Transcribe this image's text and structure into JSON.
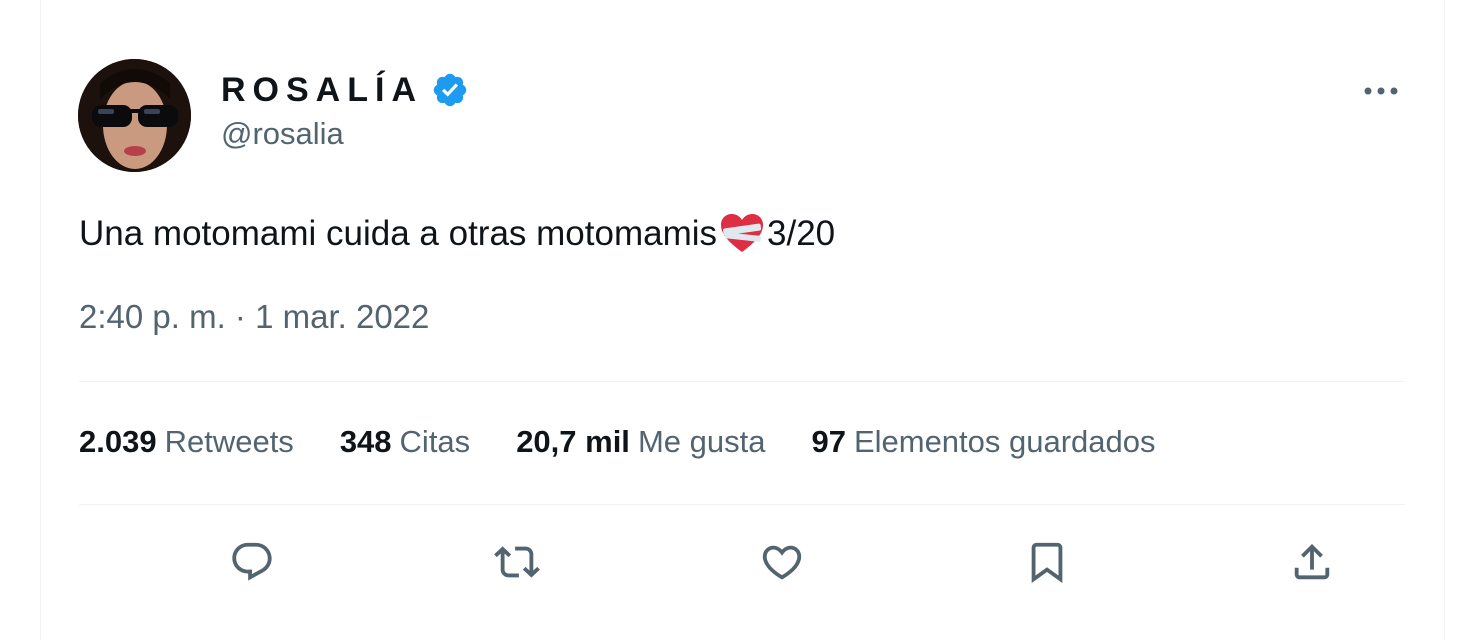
{
  "tweet": {
    "display_name": "ROSALÍA",
    "handle": "@rosalia",
    "text_before": "Una motomami cuida a otras motomamis",
    "text_after": "3/20",
    "time": "2:40 p. m.",
    "separator": "·",
    "date": "1 mar. 2022"
  },
  "stats": {
    "retweets": {
      "count": "2.039",
      "label": "Retweets"
    },
    "quotes": {
      "count": "348",
      "label": "Citas"
    },
    "likes": {
      "count": "20,7 mil",
      "label": "Me gusta"
    },
    "bookmarks": {
      "count": "97",
      "label": "Elementos guardados"
    }
  },
  "icons": {
    "verified": "verified-badge-icon",
    "more": "more-options-icon",
    "emoji": "mending-heart-icon",
    "reply": "reply-icon",
    "retweet": "retweet-icon",
    "like": "like-icon",
    "bookmark": "bookmark-icon",
    "share": "share-icon"
  },
  "colors": {
    "verified": "#1d9bf0",
    "text_primary": "#0f1419",
    "text_secondary": "#536471",
    "divider": "#eff3f4"
  }
}
